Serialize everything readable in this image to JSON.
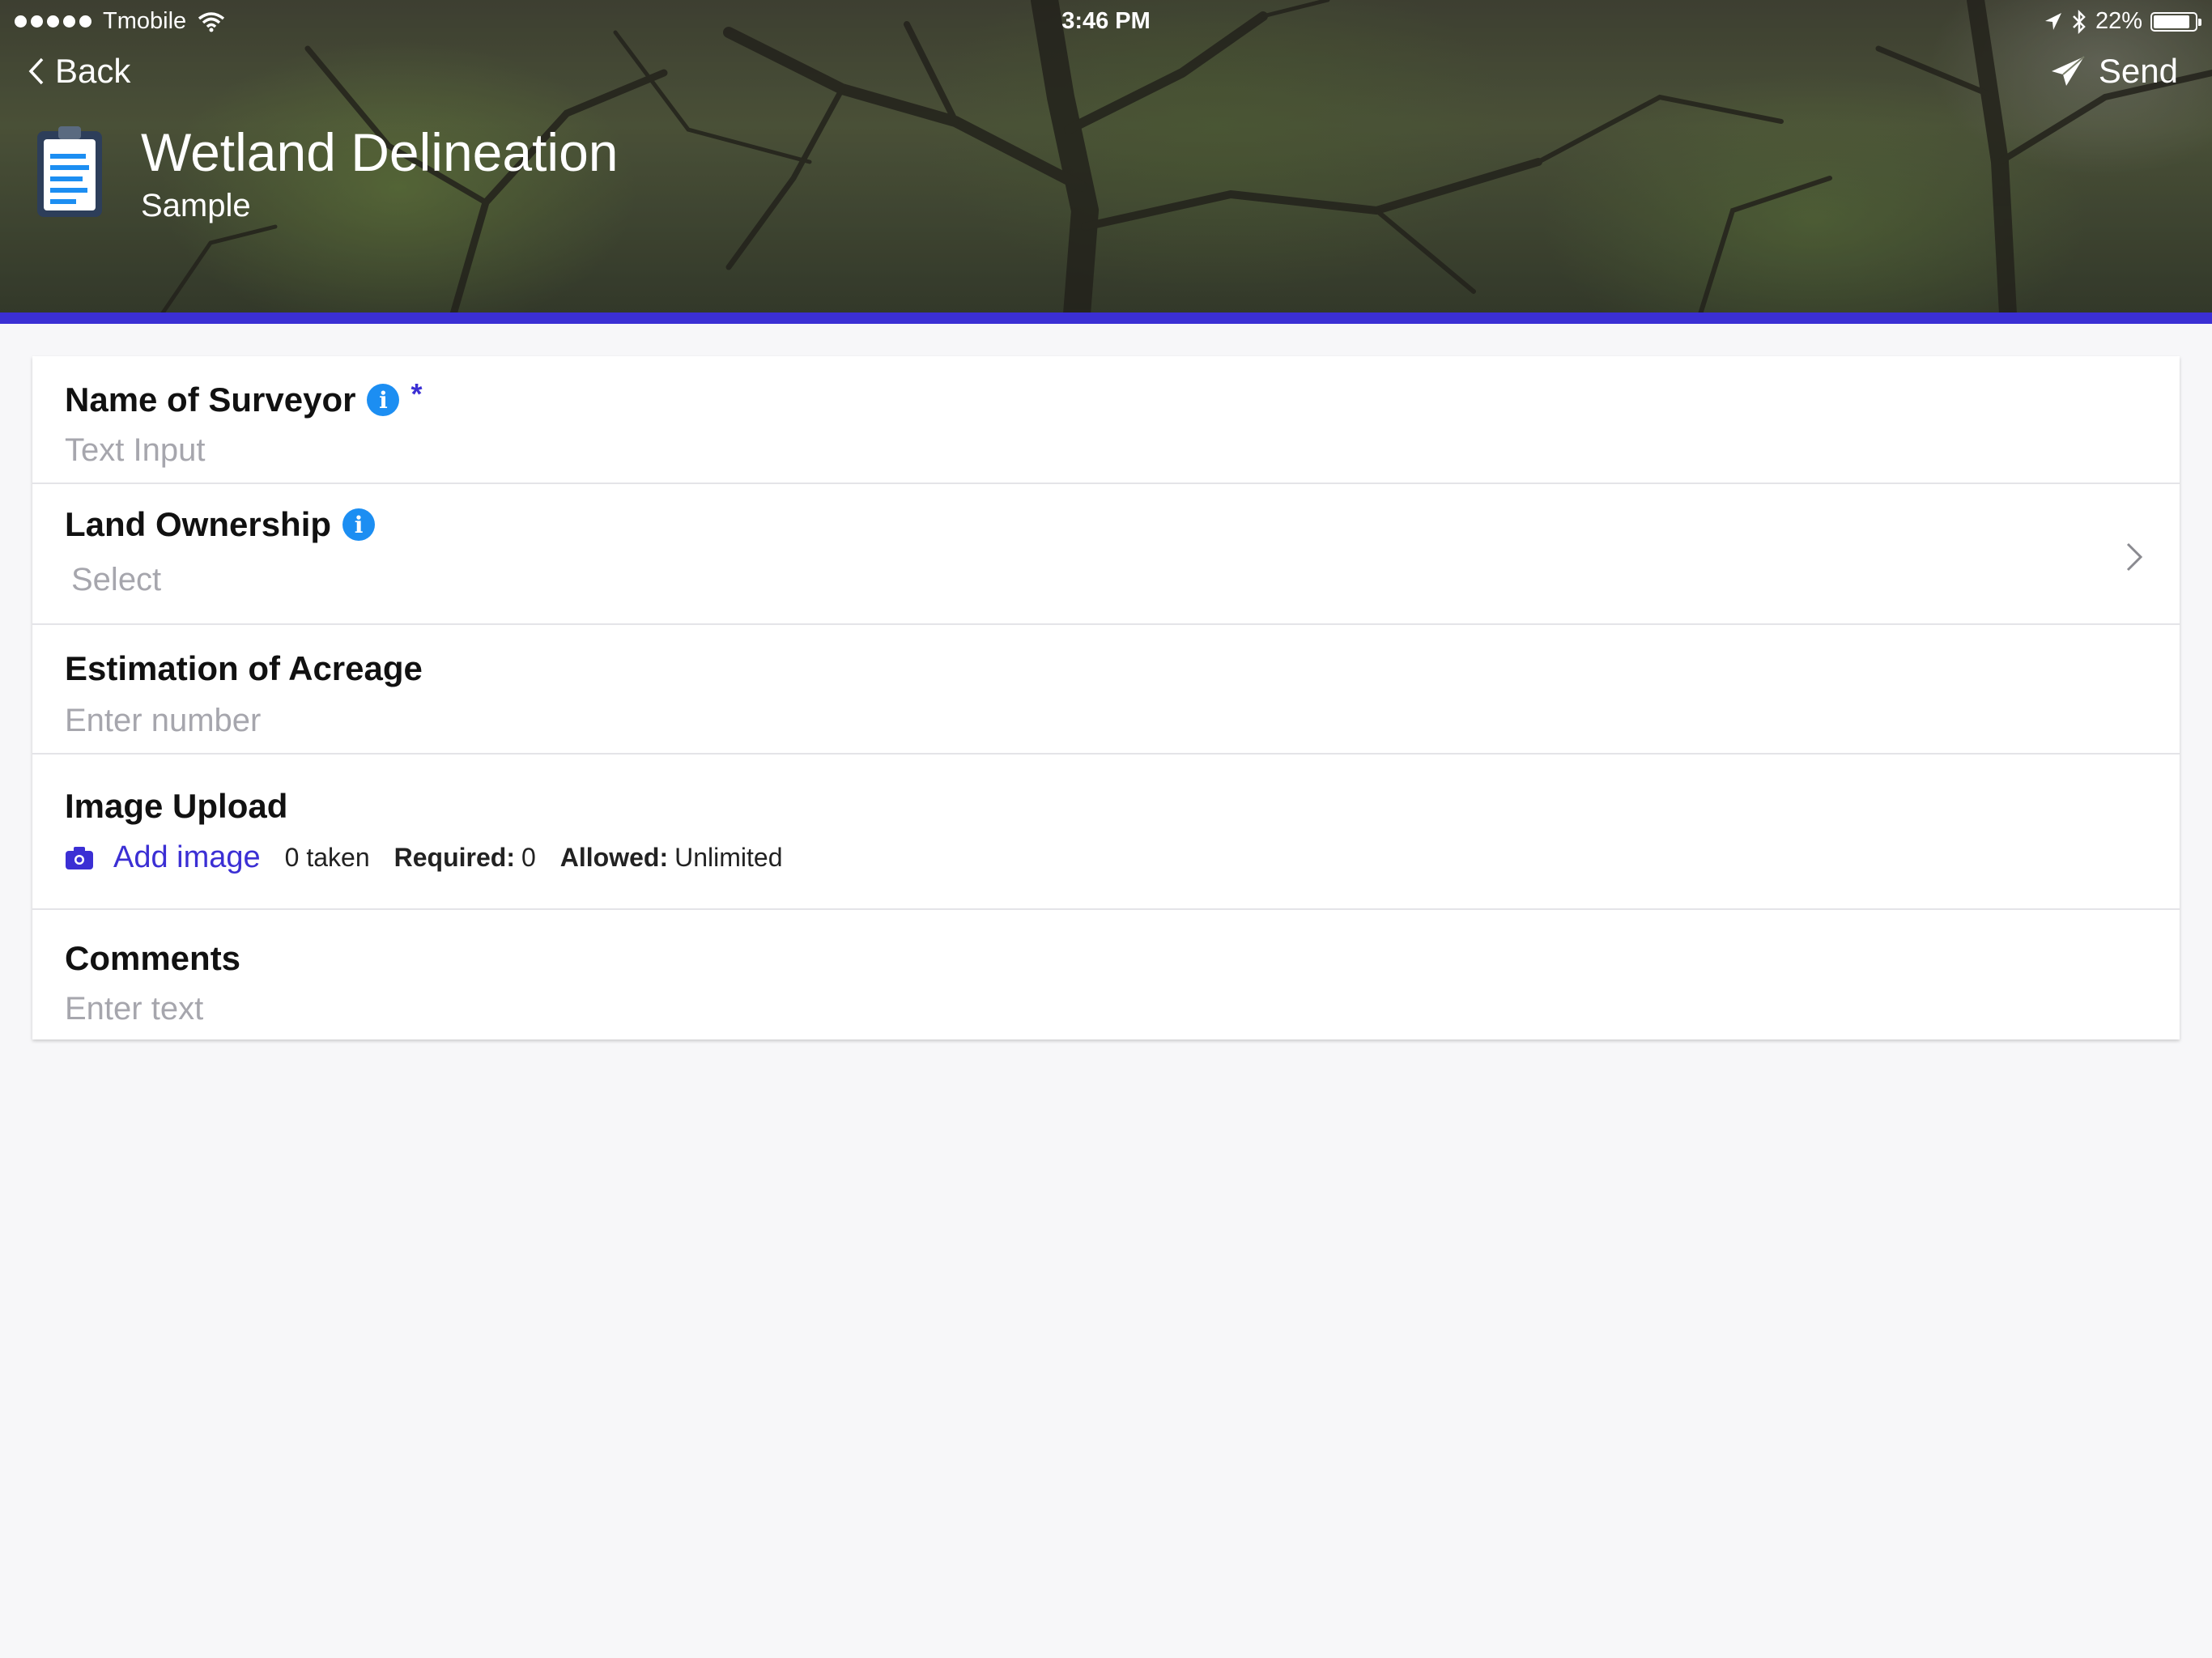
{
  "status_bar": {
    "carrier": "Tmobile",
    "time": "3:46 PM",
    "battery": "22%",
    "battery_level": 0.22
  },
  "nav": {
    "back_label": "Back",
    "send_label": "Send"
  },
  "header": {
    "title": "Wetland Delineation",
    "subtitle": "Sample"
  },
  "colors": {
    "accent": "#3b2fd4",
    "info": "#1c8ef2",
    "placeholder": "#a6a6ad"
  },
  "fields": {
    "surveyor": {
      "label": "Name of Surveyor",
      "required_mark": "*",
      "placeholder": "Text Input"
    },
    "ownership": {
      "label": "Land Ownership",
      "placeholder": "Select"
    },
    "acreage": {
      "label": "Estimation of Acreage",
      "placeholder": "Enter number"
    },
    "image_upload": {
      "label": "Image Upload",
      "add_label": "Add image",
      "taken": "0 taken",
      "required_label": "Required:",
      "required_value": "0",
      "allowed_label": "Allowed:",
      "allowed_value": "Unlimited"
    },
    "comments": {
      "label": "Comments",
      "placeholder": "Enter text"
    }
  }
}
